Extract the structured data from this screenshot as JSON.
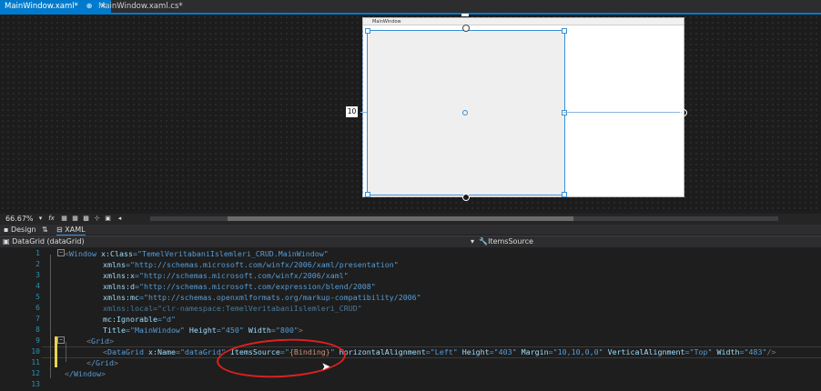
{
  "tabs": [
    {
      "label": "MainWindow.xaml*",
      "pin": "⊕",
      "close": "✕"
    },
    {
      "label": "MainWindow.xaml.cs*"
    }
  ],
  "designer": {
    "window_title": "MainWindow",
    "margin_value": "10"
  },
  "zoom": {
    "level": "66.67%",
    "fx": "fx"
  },
  "split": {
    "design": "Design",
    "swap": "⇅",
    "xaml": "XAML"
  },
  "nav": {
    "element": "DataGrid (dataGrid)",
    "property": "ItemsSource"
  },
  "line_numbers": [
    "1",
    "2",
    "3",
    "4",
    "5",
    "6",
    "7",
    "8",
    "9",
    "10",
    "11",
    "12",
    "13"
  ],
  "code": {
    "l1_tag": "Window",
    "l1_attr": " x:Class",
    "l1_val": "\"TemelVeritabaniIslemleri_CRUD.MainWindow\"",
    "l2_attr": "xmlns",
    "l2_val": "\"http://schemas.microsoft.com/winfx/2006/xaml/presentation\"",
    "l3_attr": "xmlns:x",
    "l3_val": "\"http://schemas.microsoft.com/winfx/2006/xaml\"",
    "l4_attr": "xmlns:d",
    "l4_val": "\"http://schemas.microsoft.com/expression/blend/2008\"",
    "l5_attr": "xmlns:mc",
    "l5_val": "\"http://schemas.openxmlformats.org/markup-compatibility/2006\"",
    "l6_attr": "xmlns:local",
    "l6_val": "\"clr-namespace:TemelVeritabaniIslemleri_CRUD\"",
    "l7_attr": "mc:Ignorable",
    "l7_val": "\"d\"",
    "l8_attr1": "Title",
    "l8_val1": "\"MainWindow\"",
    "l8_attr2": " Height",
    "l8_val2": "\"450\"",
    "l8_attr3": " Width",
    "l8_val3": "\"800\"",
    "l9_tag": "Grid",
    "l10_tag": "DataGrid",
    "l10_a1": " x:Name",
    "l10_v1": "\"dataGrid\"",
    "l10_a2": " ItemsSource",
    "l10_v2a": "=\"",
    "l10_v2b": "{Binding}",
    "l10_v2c": "\"",
    "l10_a3": " HorizontalAlignment",
    "l10_v3": "\"Left\"",
    "l10_a4": " Height",
    "l10_v4": "\"403\"",
    "l10_a5": " Margin",
    "l10_v5": "\"10,10,0,0\"",
    "l10_a6": " VerticalAlignment",
    "l10_v6": "\"Top\"",
    "l10_a7": " Width",
    "l10_v7": "\"483\"",
    "l11_tag": "/Grid",
    "l12_tag": "/Window"
  }
}
